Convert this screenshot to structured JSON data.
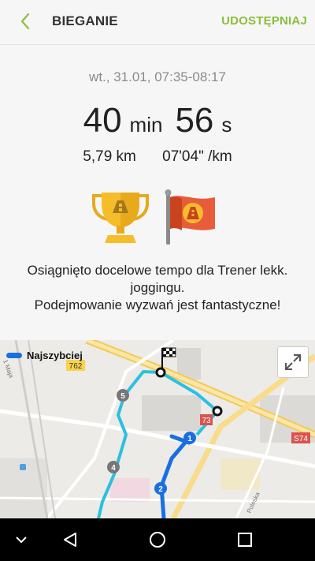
{
  "header": {
    "title": "BIEGANIE",
    "share_label": "UDOSTĘPNIAJ"
  },
  "summary": {
    "date": "wt., 31.01, 07:35-08:17",
    "minutes": "40",
    "min_unit": "min",
    "seconds": "56",
    "sec_unit": "s",
    "distance": "5,79 km",
    "pace": "07'04\" /km"
  },
  "message": {
    "line1": "Osiągnięto docelowe tempo dla Trener lekk. joggingu.",
    "line2": "Podejmowanie wyzwań jest fantastyczne!"
  },
  "map": {
    "legend_label": "Najszybciej",
    "legend_color": "#1a6fe0",
    "route_color": "#2ac0e0",
    "markers": [
      "1",
      "2",
      "4",
      "5"
    ],
    "road_labels": [
      "762",
      "73",
      "S74"
    ],
    "street_labels": [
      "1 Maja",
      "Poleska"
    ]
  },
  "navbar": {
    "icons": [
      "chevron-down-icon",
      "back-triangle-icon",
      "home-circle-icon",
      "recents-square-icon"
    ]
  }
}
